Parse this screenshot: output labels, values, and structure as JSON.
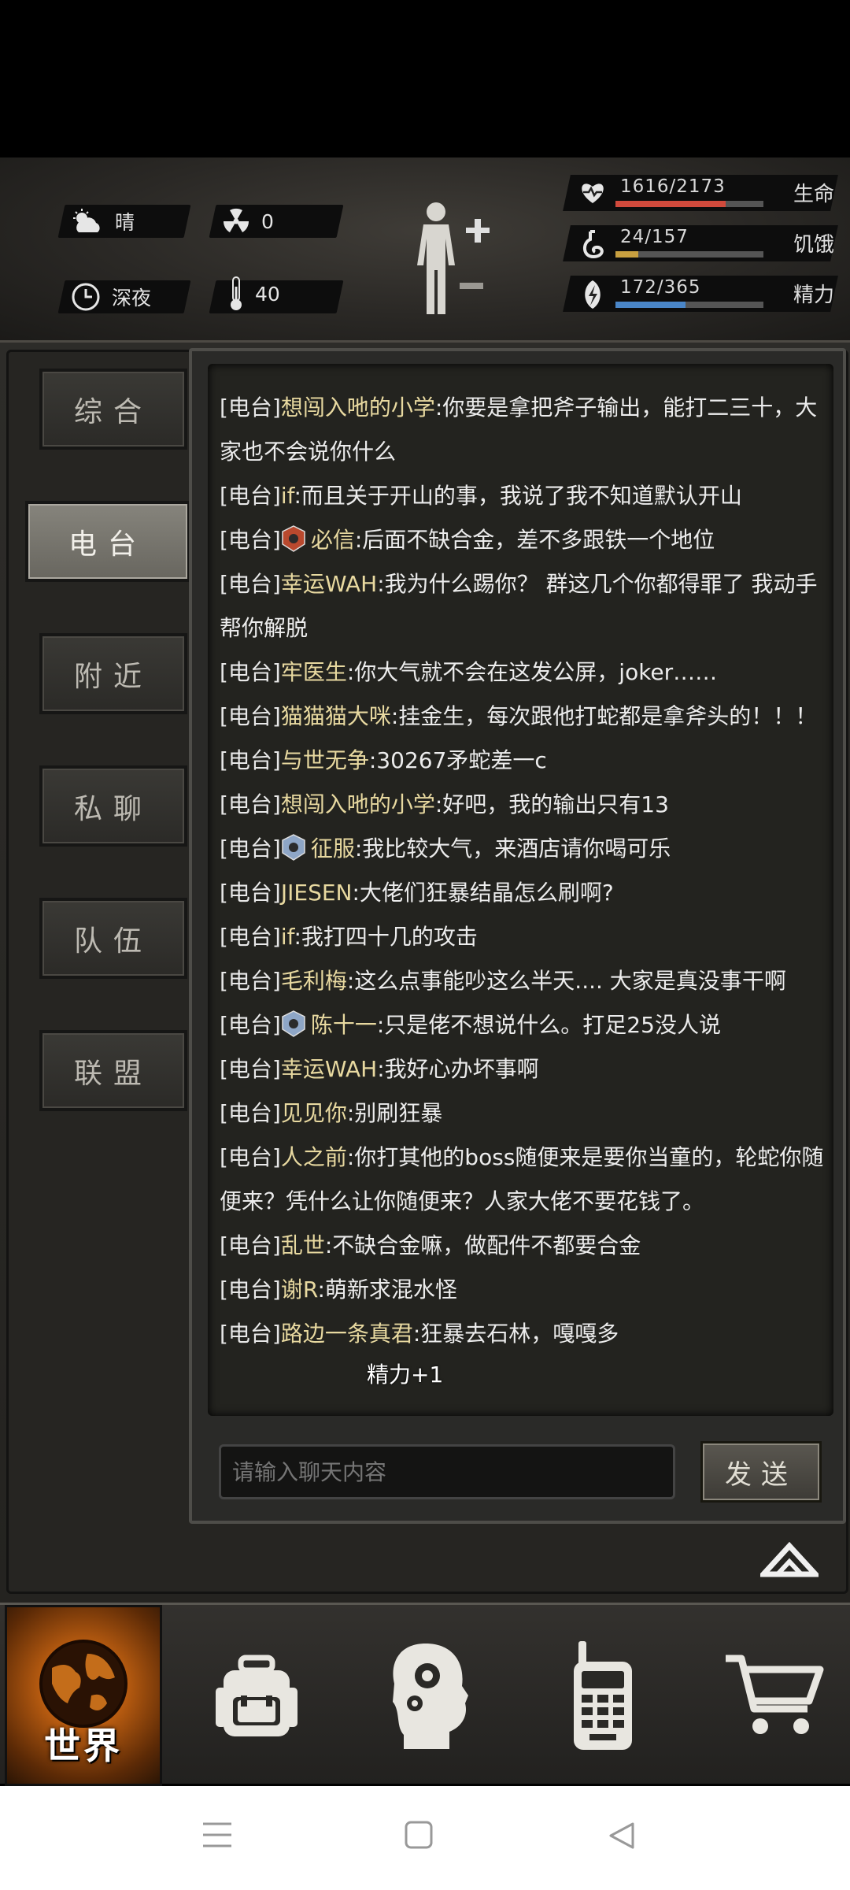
{
  "hud": {
    "weather": "晴",
    "radiation": "0",
    "time_of_day": "深夜",
    "temperature": "40",
    "stats": [
      {
        "name": "生命",
        "value": "1616/2173",
        "fraction": 0.744,
        "color": "#d14a3c",
        "icon": "heart-icon"
      },
      {
        "name": "饥饿",
        "value": "24/157",
        "fraction": 0.153,
        "color": "#c8a040",
        "icon": "stomach-icon"
      },
      {
        "name": "精力",
        "value": "172/365",
        "fraction": 0.471,
        "color": "#4a86c8",
        "icon": "energy-icon"
      }
    ]
  },
  "tabs": [
    {
      "label": "综合",
      "active": false
    },
    {
      "label": "电台",
      "active": true
    },
    {
      "label": "附近",
      "active": false
    },
    {
      "label": "私聊",
      "active": false
    },
    {
      "label": "队伍",
      "active": false
    },
    {
      "label": "联盟",
      "active": false
    }
  ],
  "chat": {
    "channel": "[电台]",
    "messages": [
      {
        "name": "想闯入吔的小学",
        "text": ":你要是拿把斧子输出，能打二三十，大家也不会说你什么",
        "avatar": ""
      },
      {
        "name": "if",
        "text": ":而且关于开山的事，我说了我不知道默认开山",
        "avatar": ""
      },
      {
        "name": "必信",
        "text": ":后面不缺合金，差不多跟铁一个地位",
        "avatar": "badge-red"
      },
      {
        "name": "幸运WAH",
        "text": ":我为什么踢你？ 群这几个你都得罪了 我动手帮你解脱",
        "avatar": ""
      },
      {
        "name": "牢医生",
        "text": ":你大气就不会在这发公屏，joker……",
        "avatar": ""
      },
      {
        "name": "猫猫猫大咪",
        "text": ":挂金生，每次跟他打蛇都是拿斧头的！！！",
        "avatar": ""
      },
      {
        "name": "与世无争",
        "text": ":30267矛蛇差一c",
        "avatar": ""
      },
      {
        "name": "想闯入吔的小学",
        "text": ":好吧，我的输出只有13",
        "avatar": ""
      },
      {
        "name": "征服",
        "text": ":我比较大气，来酒店请你喝可乐",
        "avatar": "badge-blue"
      },
      {
        "name": "JIESEN",
        "text": ":大佬们狂暴结晶怎么刷啊?",
        "avatar": ""
      },
      {
        "name": "if",
        "text": ":我打四十几的攻击",
        "avatar": ""
      },
      {
        "name": "毛利梅",
        "text": ":这么点事能吵这么半天.... 大家是真没事干啊",
        "avatar": ""
      },
      {
        "name": "陈十一",
        "text": ":只是佬不想说什么。打足25没人说",
        "avatar": "badge-blue"
      },
      {
        "name": "幸运WAH",
        "text": ":我好心办坏事啊",
        "avatar": ""
      },
      {
        "name": "见见你",
        "text": ":别刷狂暴",
        "avatar": ""
      },
      {
        "name": "人之前",
        "text": ":你打其他的boss随便来是要你当童的，轮蛇你随便来？凭什么让你随便来？人家大佬不要花钱了。",
        "avatar": ""
      },
      {
        "name": "乱世",
        "text": ":不缺合金嘛，做配件不都要合金",
        "avatar": ""
      },
      {
        "name": "谢R",
        "text": ":萌新求混水怪",
        "avatar": ""
      },
      {
        "name": "路边一条真君",
        "text": ":狂暴去石林，嘎嘎多",
        "avatar": ""
      }
    ],
    "floating_text": "精力+1",
    "input_placeholder": "请输入聊天内容",
    "send_label": "发送"
  },
  "bottom_nav": {
    "world_label": "世界",
    "items": [
      "world-icon",
      "backpack-icon",
      "skills-head-icon",
      "radio-icon",
      "cart-icon"
    ]
  }
}
